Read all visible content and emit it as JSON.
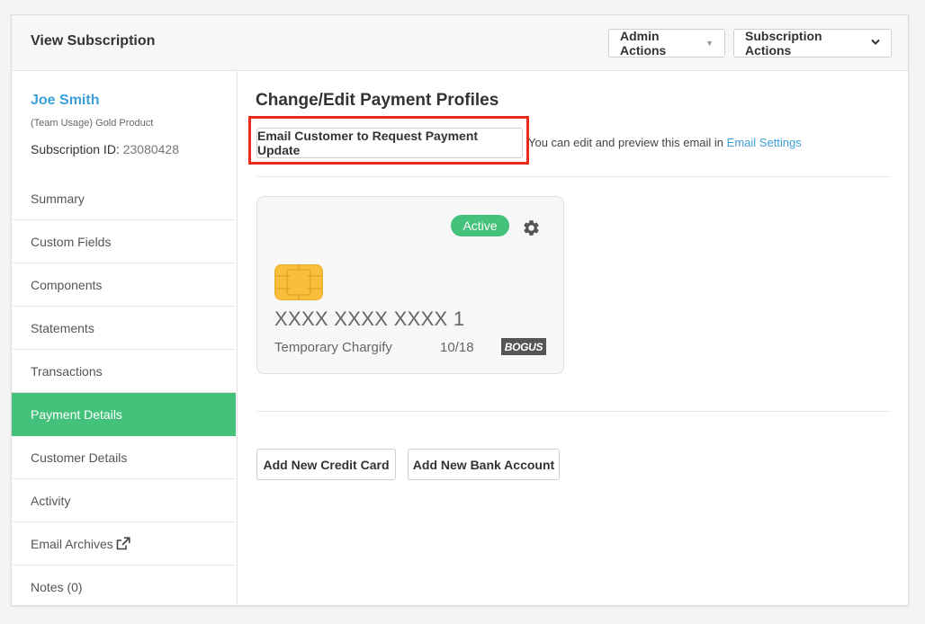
{
  "header": {
    "title": "View Subscription",
    "admin_actions": "Admin Actions",
    "subscription_actions": "Subscription Actions"
  },
  "customer": {
    "name": "Joe Smith",
    "product": "(Team Usage) Gold Product",
    "subscription_id_label": "Subscription ID:",
    "subscription_id": "23080428"
  },
  "nav": {
    "items": [
      {
        "label": "Summary"
      },
      {
        "label": "Custom Fields"
      },
      {
        "label": "Components"
      },
      {
        "label": "Statements"
      },
      {
        "label": "Transactions"
      },
      {
        "label": "Payment Details",
        "active": true
      },
      {
        "label": "Customer Details"
      },
      {
        "label": "Activity"
      },
      {
        "label": "Email Archives",
        "icon": "external-link-icon"
      },
      {
        "label": "Notes (0)"
      }
    ]
  },
  "main": {
    "title": "Change/Edit Payment Profiles",
    "email_button": "Email Customer to Request Payment Update",
    "email_note": "You can edit and preview this email in",
    "email_settings_link": "Email Settings",
    "add_credit_card": "Add New Credit Card",
    "add_bank_account": "Add New Bank Account"
  },
  "card": {
    "status": "Active",
    "number": "XXXX XXXX XXXX 1",
    "name": "Temporary Chargify",
    "expiry": "10/18",
    "brand": "BOGUS",
    "icons": [
      "gear-icon",
      "card-chip-icon"
    ]
  },
  "colors": {
    "accent_green": "#44c17b",
    "link_blue": "#3b9fd8",
    "highlight_red": "#e8291c"
  }
}
